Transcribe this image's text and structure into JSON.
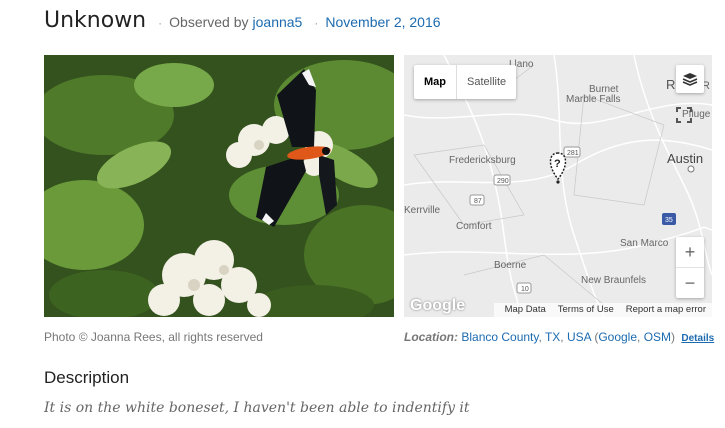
{
  "observation": {
    "title": "Unknown",
    "observed_by_label": "Observed by",
    "observer": "joanna5",
    "date": "November 2, 2016",
    "separator": "·"
  },
  "photo": {
    "credit": "Photo © Joanna Rees, all rights reserved",
    "subject_icon": "butterfly-moth-photo"
  },
  "map": {
    "tabs": [
      "Map",
      "Satellite"
    ],
    "active_tab": "Map",
    "zoom_in": "+",
    "zoom_out": "−",
    "footer": [
      "Map Data",
      "Terms of Use",
      "Report a map error"
    ],
    "logo": "Google",
    "places": [
      "Llano",
      "Burnet",
      "Marble Falls",
      "Round Rock",
      "Pflugerville",
      "Austin",
      "Fredericksburg",
      "Kerrville",
      "Comfort",
      "Boerne",
      "New Braunfels",
      "San Marcos"
    ],
    "road_shields": [
      "281",
      "290",
      "87",
      "10",
      "35"
    ]
  },
  "location": {
    "label": "Location:",
    "county": "Blanco County",
    "state": "TX",
    "country": "USA",
    "google": "Google",
    "osm": "OSM",
    "details": "Details"
  },
  "description": {
    "heading": "Description",
    "text": "It is on the white boneset, I haven't been able to indentify it"
  }
}
